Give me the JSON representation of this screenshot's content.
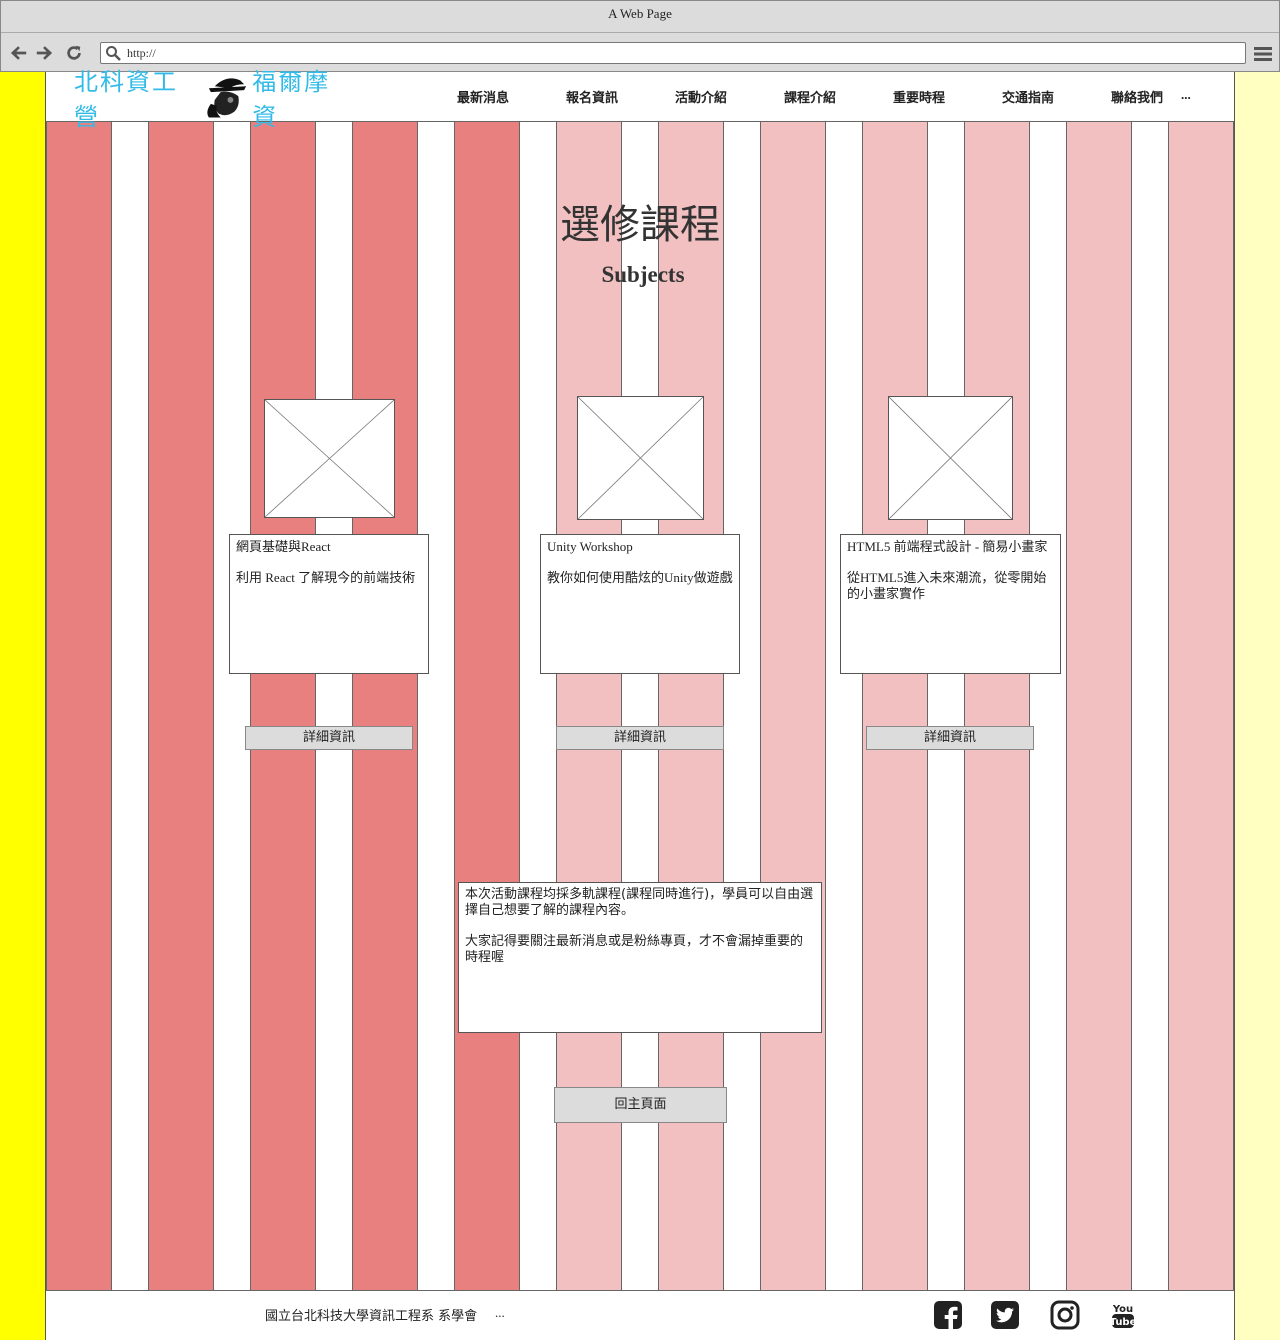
{
  "browser": {
    "window_title": "A Web Page",
    "url": "http://"
  },
  "header": {
    "logo_left": "北科資工營",
    "logo_right": "福爾摩資",
    "nav": [
      "最新消息",
      "報名資訊",
      "活動介紹",
      "課程介紹",
      "重要時程",
      "交通指南",
      "聯絡我們"
    ],
    "nav_more": "..."
  },
  "main": {
    "title": "選修課程",
    "subtitle": "Subjects",
    "courses": [
      {
        "name": "網頁基礎與React",
        "description": "利用 React 了解現今的前端技術",
        "button": "詳細資訊"
      },
      {
        "name": "Unity Workshop",
        "description": "教你如何使用酷炫的Unity做遊戲",
        "button": "詳細資訊"
      },
      {
        "name": "HTML5 前端程式設計 - 簡易小畫家",
        "description": "從HTML5進入未來潮流，從零開始的小畫家實作",
        "button": "詳細資訊"
      }
    ],
    "notice": {
      "line1": "本次活動課程均採多軌課程(課程同時進行)，學員可以自由選擇自己想要了解的課程內容。",
      "line2": "大家記得要關注最新消息或是粉絲專頁，才不會漏掉重要的時程喔"
    },
    "back_button": "回主頁面"
  },
  "footer": {
    "text": "國立台北科技大學資訊工程系 系學會",
    "more": "...",
    "social_icons": [
      "facebook-icon",
      "twitter-icon",
      "instagram-icon",
      "youtube-icon"
    ]
  },
  "colors": {
    "left_sidebar": "#ffff00",
    "right_sidebar": "#ffffc2",
    "stripe_dark": "#e88080",
    "stripe_light": "#f2c0c0",
    "logo": "#33bbe8"
  }
}
